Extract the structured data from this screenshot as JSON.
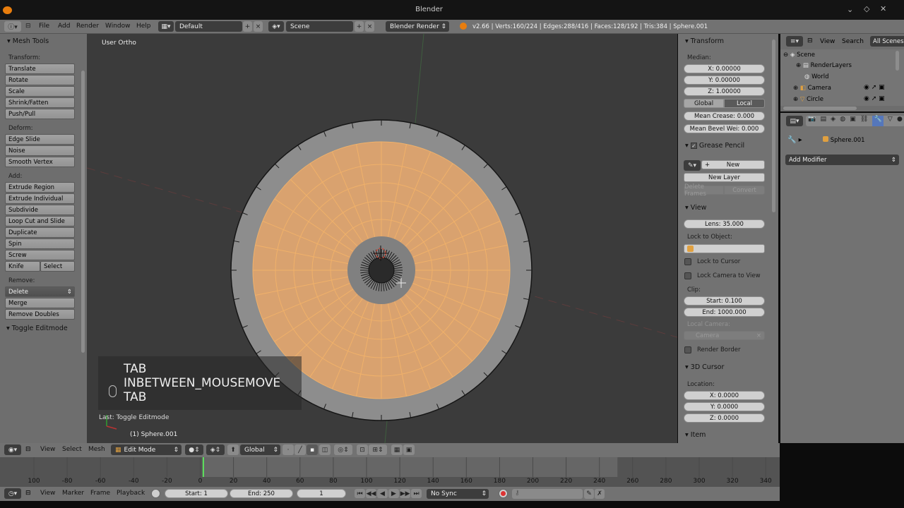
{
  "window": {
    "title": "Blender"
  },
  "info_header": {
    "menus": [
      "File",
      "Add",
      "Render",
      "Window",
      "Help"
    ],
    "layout_name": "Default",
    "scene_name": "Scene",
    "render_engine": "Blender Render",
    "stats": "v2.66 | Verts:160/224 | Edges:288/416 | Faces:128/192 | Tris:384 | Sphere.001"
  },
  "tool_shelf": {
    "title": "Mesh Tools",
    "transform_label": "Transform:",
    "transform_buttons": [
      "Translate",
      "Rotate",
      "Scale",
      "Shrink/Fatten",
      "Push/Pull"
    ],
    "deform_label": "Deform:",
    "deform_buttons": [
      "Edge Slide",
      "Noise",
      "Smooth Vertex"
    ],
    "add_label": "Add:",
    "add_buttons": [
      "Extrude Region",
      "Extrude Individual",
      "Subdivide",
      "Loop Cut and Slide",
      "Duplicate",
      "Spin",
      "Screw"
    ],
    "knife_label": "Knife",
    "select_label": "Select",
    "remove_label": "Remove:",
    "delete_label": "Delete",
    "remove_buttons": [
      "Merge",
      "Remove Doubles"
    ],
    "last_operator_title": "Toggle Editmode"
  },
  "viewport": {
    "view_name": "User Ortho",
    "screencast_keys": [
      "TAB",
      "INBETWEEN_MOUSEMOVE",
      "TAB"
    ],
    "last_operation": "Last: Toggle Editmode",
    "object_label": "(1) Sphere.001"
  },
  "properties_panel": {
    "transform_title": "Transform",
    "median_label": "Median:",
    "x": "X: 0.00000",
    "y": "Y: 0.00000",
    "z": "Z: 1.00000",
    "global_label": "Global",
    "local_label": "Local",
    "mean_crease": "Mean Crease: 0.000",
    "mean_bevel": "Mean Bevel Wei: 0.000",
    "grease_pencil_title": "Grease Pencil",
    "new_label": "New",
    "new_layer_label": "New Layer",
    "delete_frames_label": "Delete Frames",
    "convert_label": "Convert",
    "view_title": "View",
    "lens": "Lens: 35.000",
    "lock_to_object_label": "Lock to Object:",
    "lock_to_cursor": "Lock to Cursor",
    "lock_camera": "Lock Camera to View",
    "clip_label": "Clip:",
    "clip_start": "Start: 0.100",
    "clip_end": "End: 1000.000",
    "local_camera_label": "Local Camera:",
    "camera_label": "Camera",
    "render_border": "Render Border",
    "cursor_title": "3D Cursor",
    "location_label": "Location:",
    "cursor_x": "X: 0.0000",
    "cursor_y": "Y: 0.0000",
    "cursor_z": "Z: 0.0000",
    "item_title": "Item"
  },
  "outliner": {
    "view_label": "View",
    "search_label": "Search",
    "filter_label": "All Scenes",
    "items": [
      "Scene",
      "RenderLayers",
      "World",
      "Camera",
      "Circle"
    ]
  },
  "modifiers": {
    "object_name": "Sphere.001",
    "add_modifier_label": "Add Modifier"
  },
  "viewport_header": {
    "menus": [
      "View",
      "Select",
      "Mesh"
    ],
    "mode": "Edit Mode",
    "orientation": "Global"
  },
  "timeline": {
    "ticks": [
      "100",
      "-80",
      "-60",
      "-40",
      "-20",
      "0",
      "20",
      "40",
      "60",
      "80",
      "100",
      "120",
      "140",
      "160",
      "180",
      "200",
      "220",
      "240",
      "260",
      "280",
      "300",
      "320",
      "340"
    ],
    "current_frame_value": 1,
    "frame_range_start": 1,
    "frame_range_end": 250
  },
  "timeline_header": {
    "menus": [
      "View",
      "Marker",
      "Frame",
      "Playback"
    ],
    "start": "Start: 1",
    "end": "End: 250",
    "current_frame": "1",
    "sync": "No Sync"
  },
  "colors": {
    "selection_orange": "#e8a060",
    "mesh_gray": "#8c8c8c",
    "viewport_bg": "#3b3b3b",
    "panel_bg": "#727272",
    "frame_indicator": "#5ee65e"
  }
}
